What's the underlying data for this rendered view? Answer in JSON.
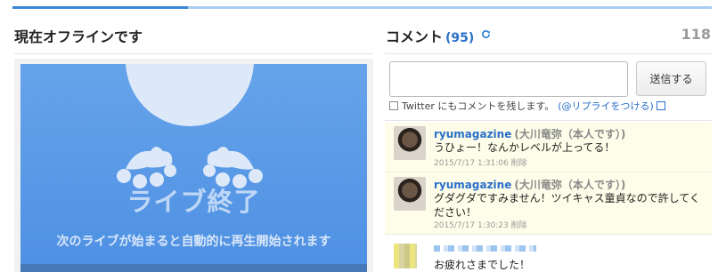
{
  "left": {
    "title": "現在オフラインです",
    "screen": {
      "heading": "ライブ終了",
      "note": "次のライブが始まると自動的に再生開始されます"
    }
  },
  "right": {
    "title": "コメント",
    "count": "(95)",
    "total": "118",
    "send_label": "送信する",
    "twitter_text": "Twitter にもコメントを残します。",
    "reply_text": "(@リプライをつける)",
    "comments": [
      {
        "user": "ryumagazine",
        "real": "(大川竜弥（本人です）)",
        "text": "うひょー！なんかレベルが上ってる！",
        "time": "2015/7/17 1:31:06",
        "delete": "削除"
      },
      {
        "user": "ryumagazine",
        "real": "(大川竜弥（本人です）)",
        "text": "グダグダですみません！ツイキャス童貞なので許してください！",
        "time": "2015/7/17 1:30:23",
        "delete": "削除"
      },
      {
        "text": "お疲れさまでした！"
      }
    ]
  },
  "colors": {
    "accent": "#3a86d8",
    "link": "#2a6fc9",
    "comment_bg": "#fdfde9",
    "screen_bg": "#5a9ae6"
  },
  "icons": [
    "refresh-icon",
    "external-link-icon",
    "checkbox",
    "user-avatar"
  ]
}
